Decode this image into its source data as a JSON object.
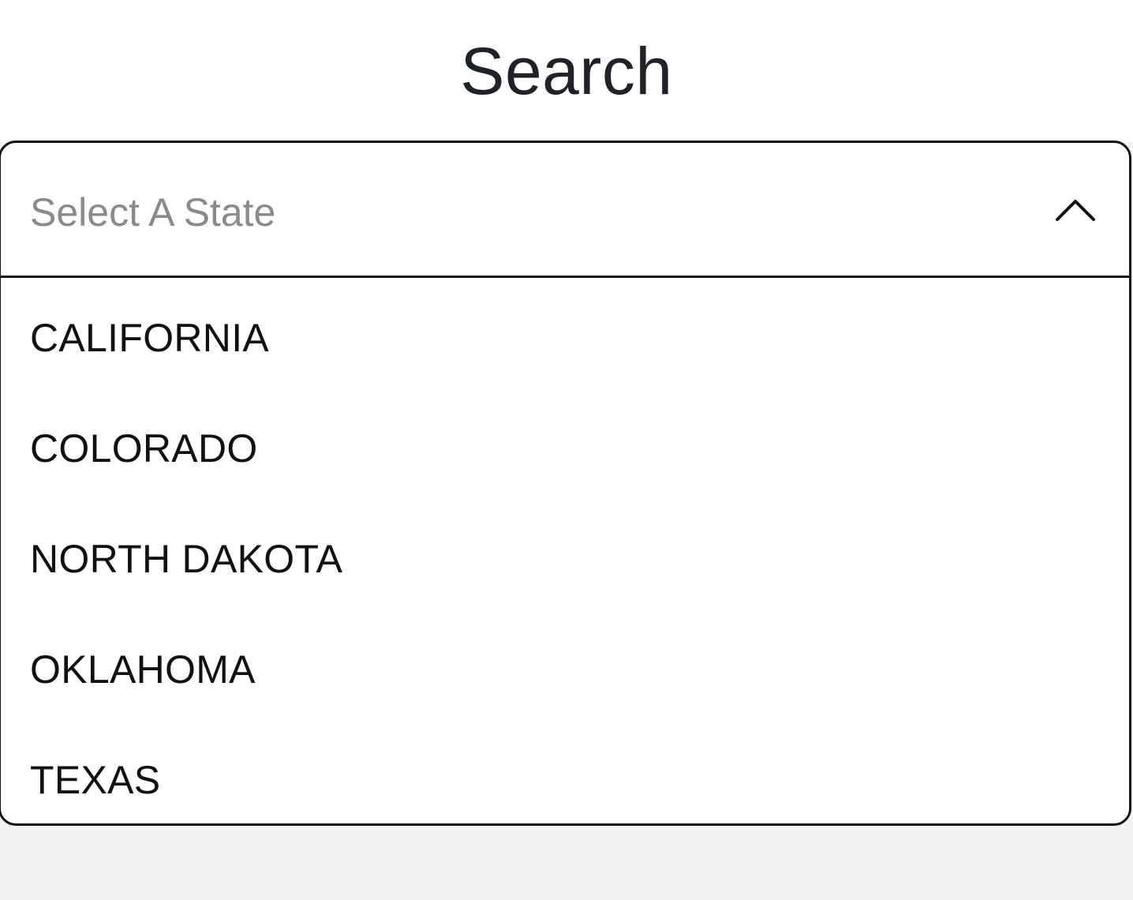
{
  "header": {
    "title": "Search"
  },
  "state_select": {
    "placeholder": "Select A State",
    "expanded": true,
    "toggle_icon": "chevron-up-icon",
    "options": [
      {
        "label": "CALIFORNIA"
      },
      {
        "label": "COLORADO"
      },
      {
        "label": "NORTH DAKOTA"
      },
      {
        "label": "OKLAHOMA"
      },
      {
        "label": "TEXAS"
      }
    ]
  },
  "colors": {
    "page_background": "#f2f2f2",
    "panel_background": "#ffffff",
    "border": "#111111",
    "placeholder_text": "#8a8a8a",
    "option_text": "#111111",
    "title_text": "#1f2328"
  }
}
